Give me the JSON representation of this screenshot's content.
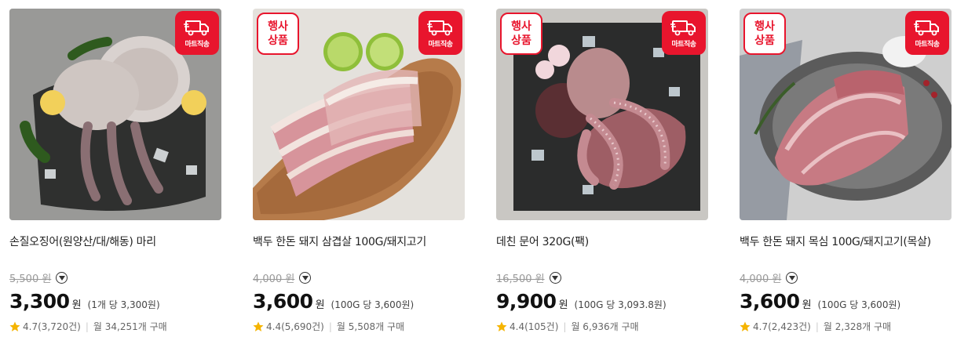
{
  "badges": {
    "event_line1": "행사",
    "event_line2": "상품",
    "mart_delivery": "마트직송"
  },
  "currency": "원",
  "colors": {
    "accent_red": "#e8152d",
    "star_yellow": "#f5b400"
  },
  "products": [
    {
      "name": "손질오징어(원양산/대/해동) 마리",
      "original_price": "5,500 원",
      "price": "3,300",
      "unit_price": "(1개 당 3,300원)",
      "rating": "4.7",
      "review_count": "(3,720건)",
      "monthly_sales": "월 34,251개 구매",
      "event": false
    },
    {
      "name": "백두 한돈 돼지 삼겹살 100G/돼지고기",
      "original_price": "4,000 원",
      "price": "3,600",
      "unit_price": "(100G 당 3,600원)",
      "rating": "4.4",
      "review_count": "(5,690건)",
      "monthly_sales": "월 5,508개 구매",
      "event": true
    },
    {
      "name": "데친 문어 320G(팩)",
      "original_price": "16,500 원",
      "price": "9,900",
      "unit_price": "(100G 당 3,093.8원)",
      "rating": "4.4",
      "review_count": "(105건)",
      "monthly_sales": "월 6,936개 구매",
      "event": true
    },
    {
      "name": "백두 한돈 돼지 목심 100G/돼지고기(목살)",
      "original_price": "4,000 원",
      "price": "3,600",
      "unit_price": "(100G 당 3,600원)",
      "rating": "4.7",
      "review_count": "(2,423건)",
      "monthly_sales": "월 2,328개 구매",
      "event": true
    }
  ]
}
